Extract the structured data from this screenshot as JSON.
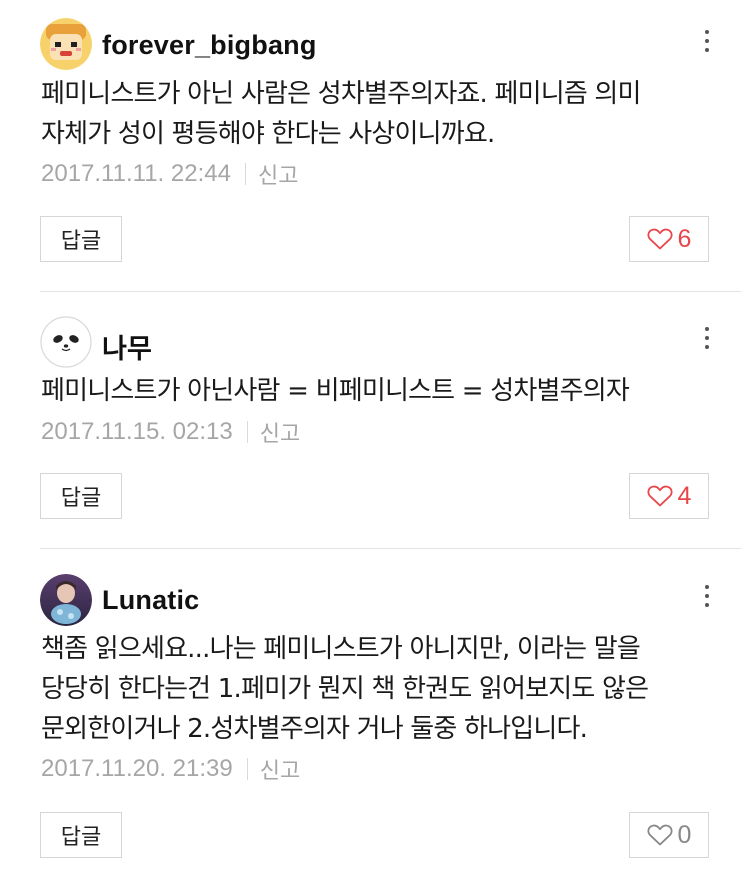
{
  "comments": [
    {
      "username": "forever_bigbang",
      "avatar_icon": "cartoon-face-avatar",
      "lines": [
        "페미니스트가 아닌 사람은 성차별주의자죠. 페미니즘 의미",
        "자체가 성이 평등해야 한다는 사상이니까요."
      ],
      "timestamp": "2017.11.11. 22:44",
      "report_label": "신고",
      "reply_label": "답글",
      "like_count": "6",
      "liked": true
    },
    {
      "username": "나무",
      "avatar_icon": "panda-face-avatar",
      "lines": [
        "페미니스트가 아닌사람 = 비페미니스트 = 성차별주의자"
      ],
      "timestamp": "2017.11.15. 02:13",
      "report_label": "신고",
      "reply_label": "답글",
      "like_count": "4",
      "liked": true
    },
    {
      "username": "Lunatic",
      "avatar_icon": "photo-avatar",
      "lines": [
        "책좀 읽으세요...나는 페미니스트가 아니지만, 이라는 말을",
        "당당히 한다는건 1.페미가 뭔지 책 한권도 읽어보지도 않은",
        "문외한이거나 2.성차별주의자 거나 둘중 하나입니다."
      ],
      "timestamp": "2017.11.20. 21:39",
      "report_label": "신고",
      "reply_label": "답글",
      "like_count": "0",
      "liked": false
    }
  ],
  "colors": {
    "like_active": "#e8464b",
    "like_inactive": "#888888",
    "meta_text": "#a6a6a6",
    "divider": "#e2e2e2"
  }
}
